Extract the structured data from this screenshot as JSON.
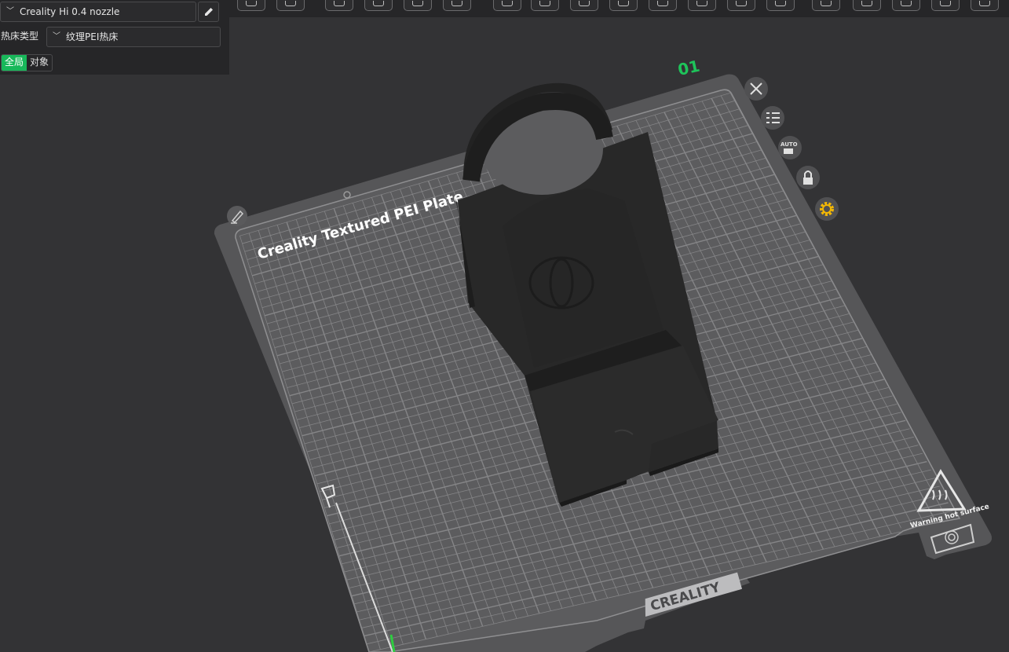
{
  "sidebar": {
    "printer_label": "Creality Hi 0.4 nozzle",
    "bed_type_label": "热床类型",
    "bed_type_value": "纹理PEI热床",
    "scope_tabs": [
      {
        "label": "全局",
        "active": true
      },
      {
        "label": "对象",
        "active": false
      }
    ]
  },
  "toolbar": {
    "icons": [
      "add-icon",
      "grid-icon",
      "orient-icon",
      "arrange-icon",
      "layout-icon",
      "split-icon",
      "plate-icon",
      "cut-icon",
      "support-icon",
      "paint-icon",
      "measure-icon",
      "assembly-icon",
      "seam-icon",
      "text-icon",
      "emboss-icon",
      "variable-layer-icon",
      "brim-icon",
      "scale-icon",
      "settings-icon",
      "view-icon"
    ]
  },
  "plate": {
    "number": "01",
    "title": "Creality Textured PEI Plate",
    "brand": "CREALITY",
    "warning_text": "Warning hot surface",
    "auto_label": "AUTO",
    "actions": [
      "close-icon",
      "list-icon",
      "auto-arrange-icon",
      "lock-icon",
      "settings-gear-icon"
    ]
  },
  "colors": {
    "accent": "#18b85a",
    "plate_number": "#1ec45a",
    "gear": "#f2b705"
  }
}
